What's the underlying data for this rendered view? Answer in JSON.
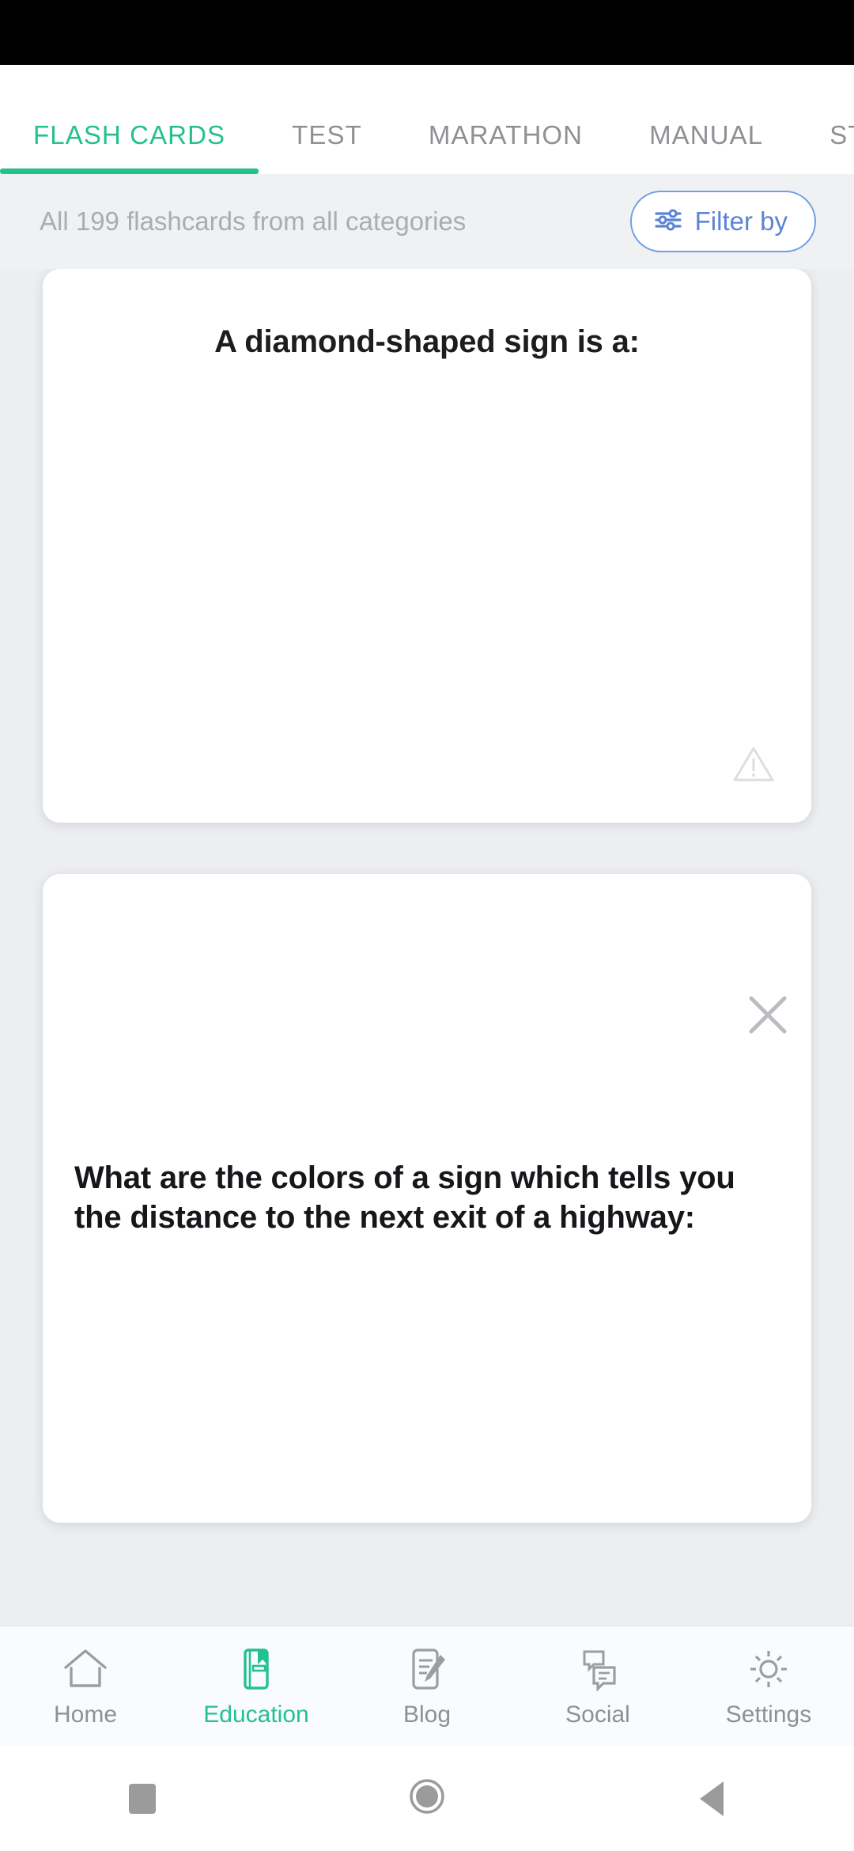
{
  "app": {
    "accent_color": "#21c28d",
    "filter_color": "#5b84d6",
    "background_color": "#eceef0"
  },
  "tabs": [
    {
      "label": "FLASH CARDS",
      "active": true
    },
    {
      "label": "TEST",
      "active": false
    },
    {
      "label": "MARATHON",
      "active": false
    },
    {
      "label": "MANUAL",
      "active": false
    },
    {
      "label": "STATISTICS",
      "active": false
    }
  ],
  "filter_bar": {
    "caption": "All 199 flashcards from all categories",
    "count": 199,
    "button_label": "Filter by",
    "button_icon": "sliders-icon"
  },
  "cards": [
    {
      "question": "A diamond-shaped sign is a:",
      "badge_icon": "warning-triangle-icon"
    },
    {
      "question": "What are the colors of a sign which tells you the distance to the next exit of a highway:"
    }
  ],
  "close_button": {
    "icon": "close-icon",
    "label": "Close"
  },
  "bottom_nav": [
    {
      "label": "Home",
      "icon": "home-icon",
      "active": false
    },
    {
      "label": "Education",
      "icon": "book-icon",
      "active": true
    },
    {
      "label": "Blog",
      "icon": "edit-note-icon",
      "active": false
    },
    {
      "label": "Social",
      "icon": "chat-icon",
      "active": false
    },
    {
      "label": "Settings",
      "icon": "gear-icon",
      "active": false
    }
  ],
  "system_nav": [
    {
      "icon": "recent-apps-square-icon"
    },
    {
      "icon": "home-circle-icon"
    },
    {
      "icon": "back-triangle-icon"
    }
  ]
}
